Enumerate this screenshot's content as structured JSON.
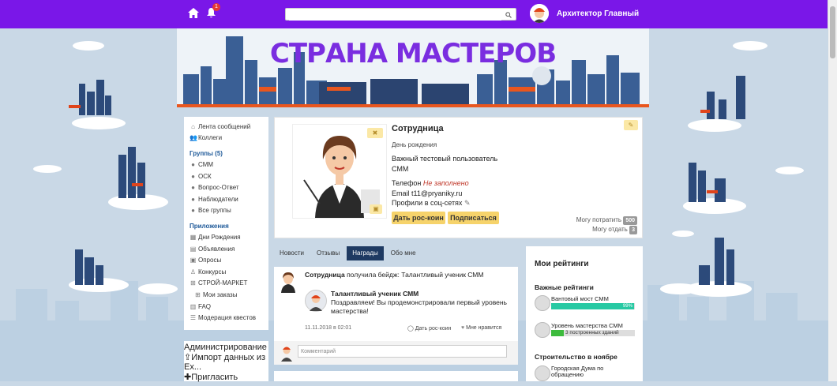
{
  "topbar": {
    "notifications_count": "1",
    "search_placeholder": "",
    "user_name": "Архитектор Главный"
  },
  "banner": {
    "title": "СТРАНА МАСТЕРОВ"
  },
  "sidebar": {
    "main": [
      {
        "label": "Лента сообщений",
        "icon": "home-icon"
      },
      {
        "label": "Коллеги",
        "icon": "users-icon"
      }
    ],
    "groups_header": "Группы (5)",
    "groups": [
      {
        "label": "СММ",
        "icon": "chat-icon"
      },
      {
        "label": "ОСК",
        "icon": "chat-icon"
      },
      {
        "label": "Вопрос-Ответ",
        "icon": "chat-icon"
      },
      {
        "label": "Наблюдатели",
        "icon": "chat-icon"
      },
      {
        "label": "Все группы",
        "icon": "chats-icon"
      }
    ],
    "apps_header": "Приложения",
    "apps": [
      {
        "label": "Дни Рождения",
        "icon": "calendar-icon"
      },
      {
        "label": "Объявления",
        "icon": "doc-icon"
      },
      {
        "label": "Опросы",
        "icon": "poll-icon"
      },
      {
        "label": "Конкурсы",
        "icon": "award-icon"
      },
      {
        "label": "СТРОЙ-МАРКЕТ",
        "icon": "cart-icon"
      },
      {
        "label": "Мои заказы",
        "icon": "cart-icon",
        "sub": true
      },
      {
        "label": "FAQ",
        "icon": "faq-icon"
      },
      {
        "label": "Модерация квестов",
        "icon": "list-icon"
      }
    ],
    "admin_header": "Администрирование",
    "admin": [
      {
        "label": "Импорт данных из Ex...",
        "icon": "import-icon"
      },
      {
        "label": "Пригласить",
        "icon": "invite-icon"
      }
    ]
  },
  "profile": {
    "name": "Сотрудница",
    "birthday_label": "День рождения",
    "description_line1": "Важный тестовый пользователь",
    "description_line2": "СММ",
    "phone_label": "Телефон",
    "phone_value": "Не заполнено",
    "email_label": "Email",
    "email_value": "t11@pryaniky.ru",
    "social_label": "Профили в соц-сетях",
    "coin_button": "Дать рос-коин",
    "subscribe_button": "Подписаться",
    "can_spend_label": "Могу потратить",
    "can_spend_value": "500",
    "can_give_label": "Могу отдать",
    "can_give_value": "3"
  },
  "tabs": [
    {
      "label": "Новости",
      "active": false
    },
    {
      "label": "Отзывы",
      "active": false
    },
    {
      "label": "Награды",
      "active": true
    },
    {
      "label": "Обо мне",
      "active": false
    }
  ],
  "feed": {
    "author": "Сотрудница",
    "action": "получила бейдж: Талантливый ученик СММ",
    "badge_title": "Талантливый ученик СММ",
    "badge_text": "Поздравляем! Вы продемонстрировали первый уровень мастерства!",
    "date": "11.11.2018 в 02:01",
    "coin_action": "Дать рос-коин",
    "like_action": "Мне нравится",
    "comment_placeholder": "Комментарий"
  },
  "ratings": {
    "title": "Мои рейтинги",
    "important_header": "Важные рейтинги",
    "items": [
      {
        "name": "Вантовый мост СММ",
        "fill_percent": 99,
        "bar_label": "99%",
        "color": "#27c9a3"
      },
      {
        "name": "Уровень мастерства СММ",
        "fill_percent": 15,
        "bar_label": "",
        "text": "3 построенных зданий",
        "color": "#3dbb3d"
      }
    ],
    "construction_header": "Строительство в ноябре",
    "construction_item": "Городская Дума по обращению"
  }
}
